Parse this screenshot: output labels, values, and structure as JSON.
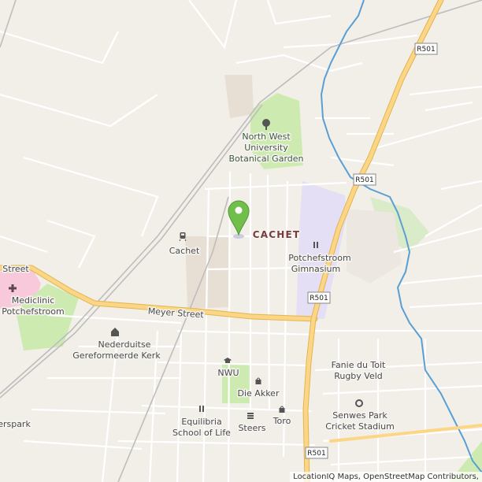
{
  "labels": {
    "cachet_area": "CACHET",
    "botanical_garden": [
      "North West",
      "University",
      "Botanical Garden"
    ],
    "cachet_station": "Cachet",
    "gimnasium": [
      "Potchefstroom",
      "Gimnasium"
    ],
    "mediclinic": [
      "Mediclinic",
      "Potchefstroom"
    ],
    "meyer_street": "Meyer Street",
    "street_left": "Street",
    "kerk": [
      "Nederduitse",
      "Gereformeerde Kerk"
    ],
    "nwu": "NWU",
    "die_akker": "Die Akker",
    "fanie": [
      "Fanie du Toit",
      "Rugby Veld"
    ],
    "senwes": [
      "Senwes Park",
      "Cricket Stadium"
    ],
    "equilibria": [
      "Equilibria",
      "School of Life"
    ],
    "steers": "Steers",
    "toro": "Toro",
    "kerspark": "erspark"
  },
  "road_shields": [
    "R501",
    "R501",
    "R501",
    "R501"
  ],
  "attribution": "LocationIQ Maps, OpenStreetMap Contributors,",
  "colors": {
    "background": "#f2efe9",
    "major_road": "#fcd685",
    "park": "#cdebb0",
    "school": "#e4dff5",
    "hospital": "#f7c9db",
    "river": "#5a9fd4",
    "marker": "#6fbf4a"
  },
  "icons": [
    "pin-marker-icon",
    "tree-icon",
    "train-icon",
    "bar-icon",
    "hospital-icon",
    "church-icon",
    "school-icon",
    "shop-icon",
    "fastfood-icon",
    "restaurant-icon",
    "stadium-icon"
  ]
}
